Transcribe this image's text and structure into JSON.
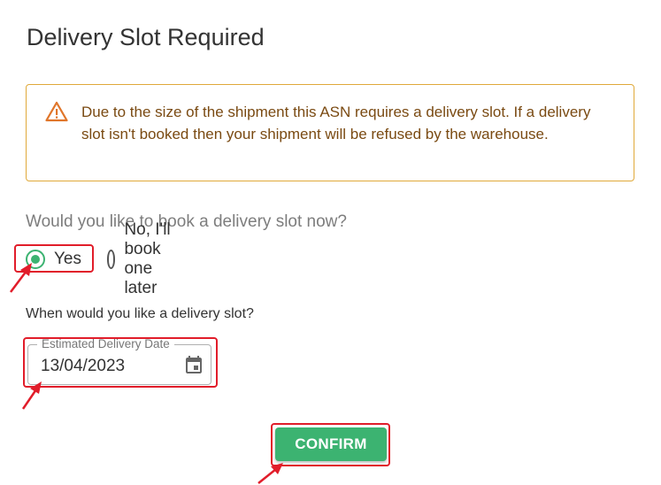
{
  "dialog": {
    "title": "Delivery Slot Required",
    "alert": {
      "icon": "warning-triangle-icon",
      "text": "Due to the size of the shipment this ASN requires a delivery slot. If a delivery slot isn't booked then your shipment will be refused by the warehouse."
    },
    "question": "Would you like to book a delivery slot now?",
    "options": [
      {
        "label": "Yes",
        "checked": true
      },
      {
        "label": "No, I'll book one later",
        "checked": false
      }
    ],
    "date_question": "When would you like a delivery slot?",
    "date_field": {
      "label": "Estimated Delivery Date",
      "value": "13/04/2023",
      "icon": "calendar-icon"
    },
    "confirm_label": "CONFIRM"
  },
  "colors": {
    "accent": "#3cb371",
    "warning_border": "#e0a93a",
    "warning_text": "#7a4a12",
    "annotation": "#e11d2a"
  }
}
